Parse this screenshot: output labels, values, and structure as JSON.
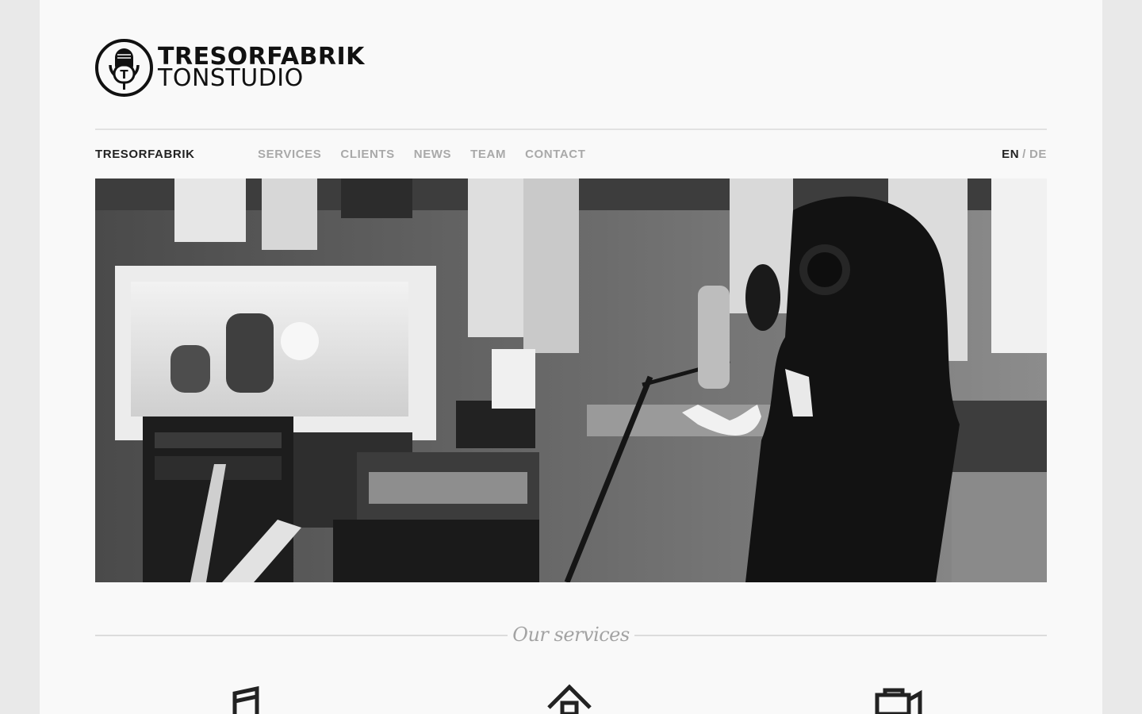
{
  "logo": {
    "line1": "TRESORFABRIK",
    "line2": "TONSTUDIO",
    "mark_letter": "T"
  },
  "nav": {
    "brand": "TRESORFABRIK",
    "links": [
      "SERVICES",
      "CLIENTS",
      "NEWS",
      "TEAM",
      "CONTACT"
    ]
  },
  "language": {
    "active": "EN",
    "separator": "/",
    "inactive": "DE"
  },
  "hero": {
    "icon": "studio-photo"
  },
  "services": {
    "title": "Our services",
    "icons": [
      "music-note-icon",
      "house-icon",
      "video-camera-icon"
    ]
  },
  "colors": {
    "page_bg": "#f9f9f9",
    "outer_bg": "#e9e9e9",
    "text": "#222222",
    "muted": "#a9a9a9"
  }
}
